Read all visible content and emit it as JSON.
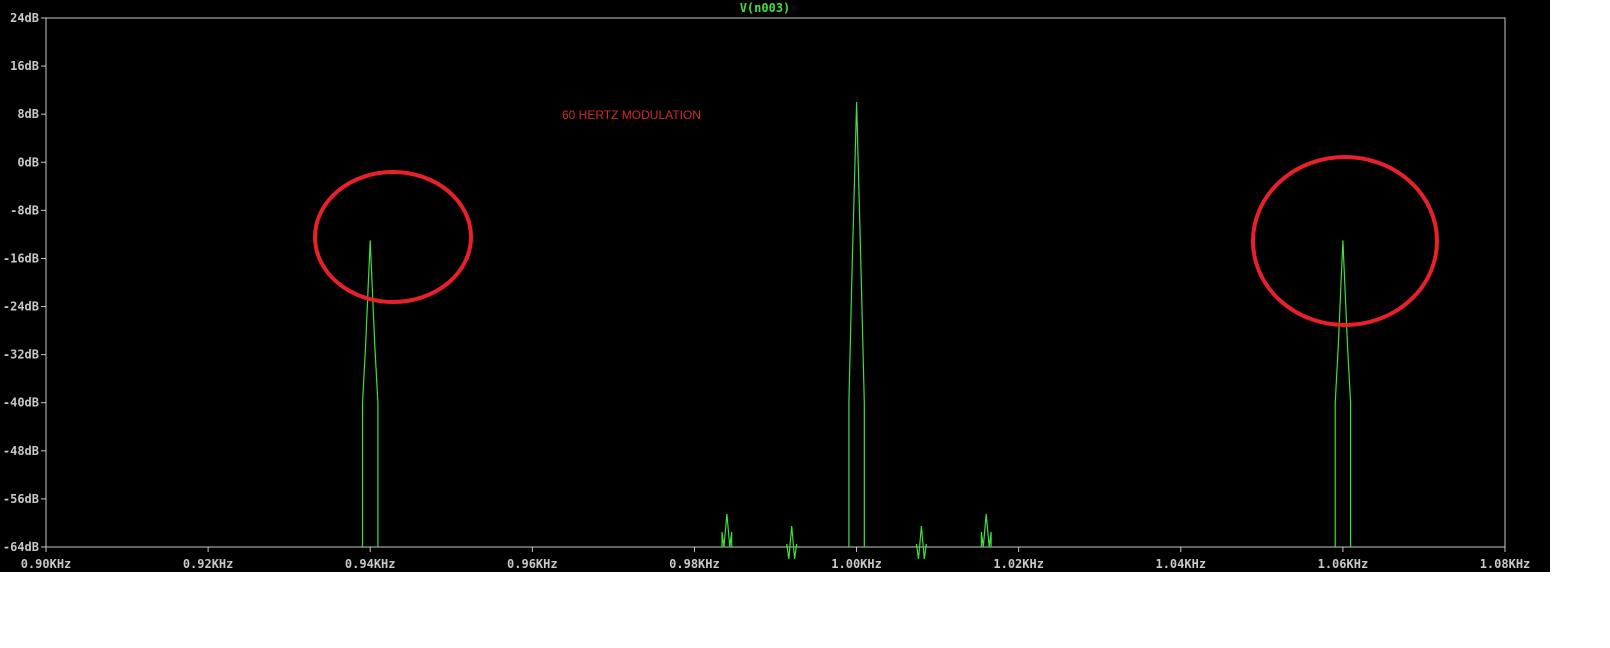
{
  "chart_data": {
    "type": "line",
    "title": "V(n003)",
    "xlabel": "",
    "ylabel": "",
    "xlim": [
      0.9,
      1.08
    ],
    "ylim": [
      -64,
      24
    ],
    "x_unit": "KHz",
    "y_unit": "dB",
    "grid": false,
    "x_ticks": [
      "0.90KHz",
      "0.92KHz",
      "0.94KHz",
      "0.96KHz",
      "0.98KHz",
      "1.00KHz",
      "1.02KHz",
      "1.04KHz",
      "1.06KHz",
      "1.08KHz"
    ],
    "y_ticks": [
      "24dB",
      "16dB",
      "8dB",
      "0dB",
      "-8dB",
      "-16dB",
      "-24dB",
      "-32dB",
      "-40dB",
      "-48dB",
      "-56dB",
      "-64dB"
    ],
    "series": [
      {
        "color": "#3ee03e",
        "peaks": [
          {
            "x": 0.94,
            "y": -13
          },
          {
            "x": 0.984,
            "y": -58.5
          },
          {
            "x": 0.992,
            "y": -60.5
          },
          {
            "x": 1.0,
            "y": 10
          },
          {
            "x": 1.008,
            "y": -60.5
          },
          {
            "x": 1.016,
            "y": -58.5
          },
          {
            "x": 1.06,
            "y": -13
          }
        ]
      }
    ],
    "annotations": {
      "text": "60 HERTZ MODULATION",
      "text_color": "#d42a2a",
      "circle_color": "#e8202a",
      "circled_peaks": [
        0.94,
        1.06
      ]
    }
  }
}
